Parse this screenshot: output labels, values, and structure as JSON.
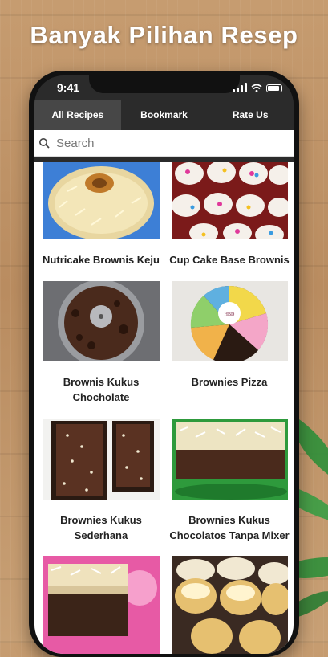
{
  "headline": "Banyak Pilihan Resep",
  "status_bar": {
    "time": "9:41"
  },
  "tabs": [
    {
      "label": "All Recipes",
      "active": true
    },
    {
      "label": "Bookmark",
      "active": false
    },
    {
      "label": "Rate Us",
      "active": false
    }
  ],
  "search": {
    "placeholder": "Search",
    "value": ""
  },
  "recipes": [
    {
      "title": "Nutricake Brownis Keju",
      "image": "cheese-bundt-cake"
    },
    {
      "title": "Cup Cake Base Brownis",
      "image": "frosted-cupcakes"
    },
    {
      "title": "Brownis Kukus Chocholate",
      "image": "chocolate-ring-cake-in-pan"
    },
    {
      "title": "Brownies Pizza",
      "image": "colorful-pizza-brownie"
    },
    {
      "title": "Brownies Kukus Sederhana",
      "image": "brownie-loaves-in-tray"
    },
    {
      "title": "Brownies Kukus Chocolatos Tanpa Mixer",
      "image": "cheese-topped-brownie"
    },
    {
      "title": "",
      "image": "cheese-layer-brownie"
    },
    {
      "title": "",
      "image": "cheese-cupcakes"
    }
  ],
  "colors": {
    "tab_bar": "#2b2b2b",
    "active_tab": "#474747",
    "headline": "#ffffff",
    "wood": "#c69c70"
  }
}
